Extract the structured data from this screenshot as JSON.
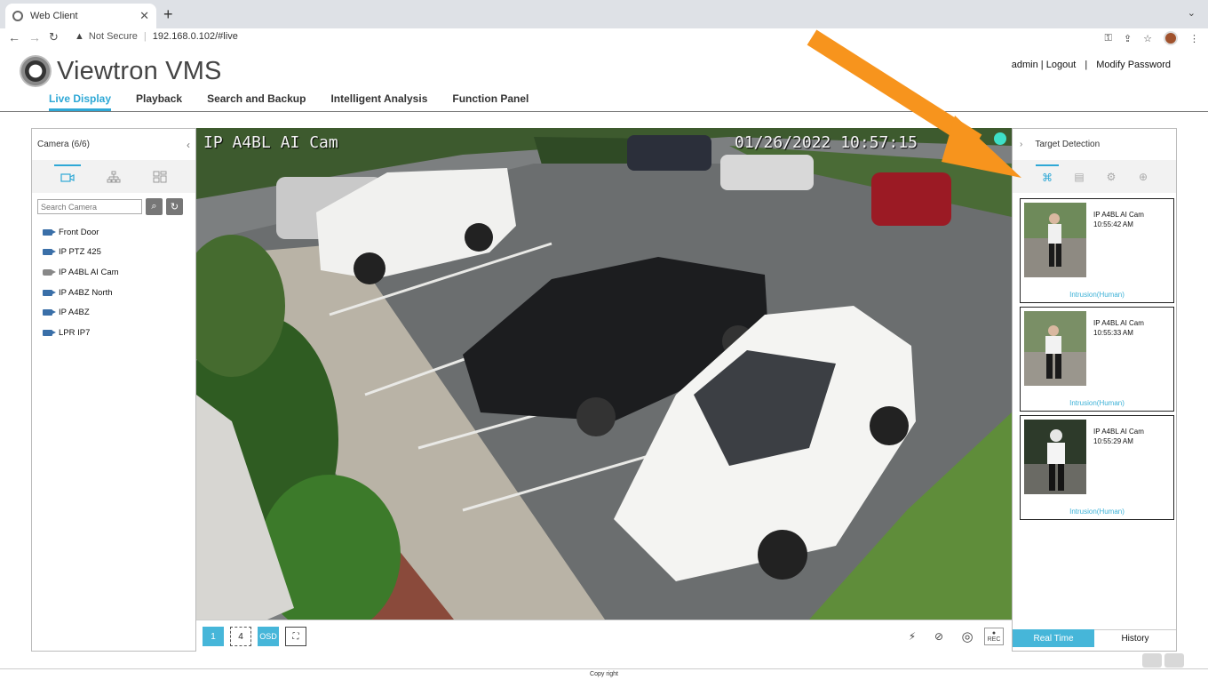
{
  "browser": {
    "tab_title": "Web Client",
    "new_tab": "+",
    "security_label": "Not Secure",
    "url": "192.168.0.102/#live"
  },
  "header": {
    "app_name": "Viewtron VMS",
    "user": "admin",
    "logout": "Logout",
    "modify_password": "Modify Password",
    "nav": [
      "Live Display",
      "Playback",
      "Search and Backup",
      "Intelligent Analysis",
      "Function Panel"
    ]
  },
  "left_panel": {
    "title": "Camera (6/6)",
    "search_placeholder": "Search Camera",
    "cameras": [
      "Front Door",
      "IP PTZ 425",
      "IP A4BL AI Cam",
      "IP A4BZ North",
      "IP A4BZ",
      "LPR IP7"
    ]
  },
  "video": {
    "camera_name": "IP A4BL AI Cam",
    "timestamp": "01/26/2022 10:57:15"
  },
  "bottom_bar": {
    "layout_1": "1",
    "layout_4": "4",
    "osd": "OSD",
    "rec": "REC"
  },
  "right_panel": {
    "title": "Target Detection",
    "detections": [
      {
        "camera": "IP A4BL AI Cam",
        "time": "10:55:42 AM",
        "type": "Intrusion(Human)"
      },
      {
        "camera": "IP A4BL AI Cam",
        "time": "10:55:33 AM",
        "type": "Intrusion(Human)"
      },
      {
        "camera": "IP A4BL AI Cam",
        "time": "10:55:29 AM",
        "type": "Intrusion(Human)"
      }
    ],
    "real_time": "Real Time",
    "history": "History"
  },
  "footer": {
    "copyright": "Copy right"
  },
  "colors": {
    "accent": "#2ea8d6",
    "annotation_arrow": "#f7941d"
  }
}
